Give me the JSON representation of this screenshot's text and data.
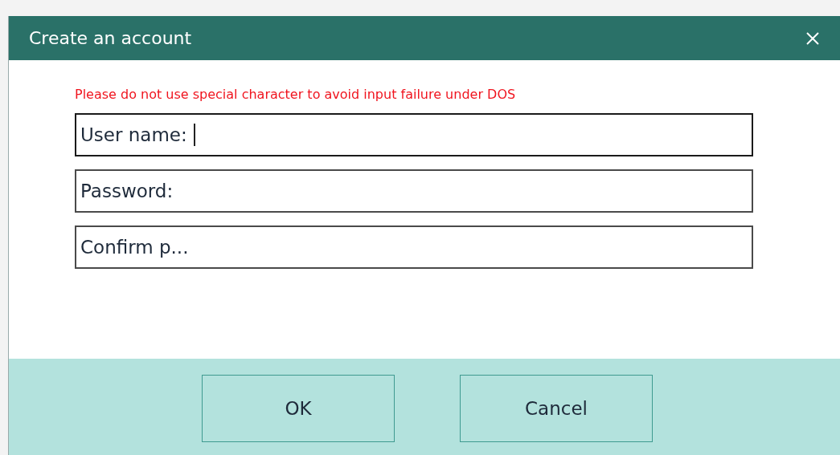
{
  "dialog": {
    "title": "Create an account"
  },
  "warning": "Please do not use special character to avoid input failure under DOS",
  "fields": [
    {
      "label": "User name:",
      "focused": true
    },
    {
      "label": "Password:",
      "focused": false
    },
    {
      "label": "Confirm p...",
      "focused": false
    }
  ],
  "buttons": [
    "OK",
    "Cancel"
  ]
}
